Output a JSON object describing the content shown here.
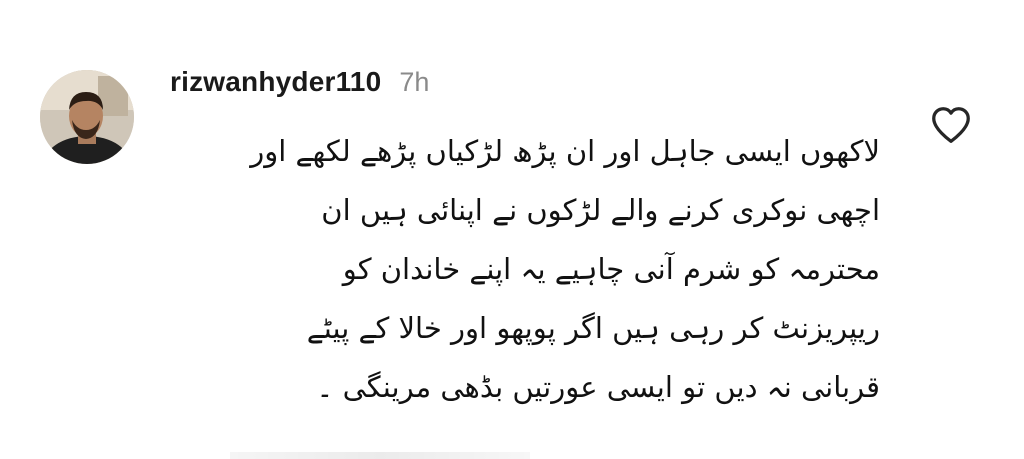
{
  "comment": {
    "avatar_icon": "user-avatar-photo",
    "username": "rizwanhyder110",
    "timestamp": "7h",
    "like_icon": "heart-outline-icon",
    "text_lines": [
      "لاکھوں ایسی جاہل اور ان پڑھ لڑکیاں پڑھے لکھے اور",
      "اچھی نوکری کرنے والے لڑکوں نے اپنائی ہیں ان",
      "محترمہ کو شرم آنی چاہیے یہ اپنے خاندان کو",
      "ریپریزنٹ کر رہی ہیں اگر پوپھو اور خالا کے پیٹے",
      "قربانی نہ دیں تو ایسی عورتیں بڈھی مرینگی ۔"
    ]
  },
  "colors": {
    "username": "#1a1a1a",
    "timestamp": "#8a8a8a",
    "comment_text": "#111111",
    "icon_stroke": "#262626",
    "background": "#ffffff"
  }
}
